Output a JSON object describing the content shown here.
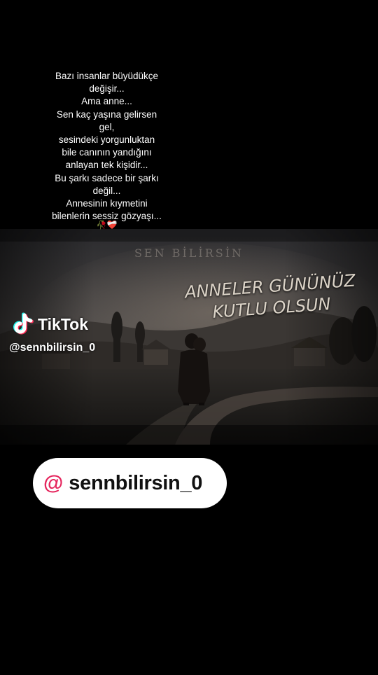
{
  "caption": {
    "lines": [
      "Bazı insanlar büyüdükçe",
      "değişir...",
      "Ama anne...",
      "Sen kaç yaşına gelirsen",
      "gel,",
      "sesindeki yorgunluktan",
      "bile canının yandığını",
      "anlayan tek kişidir...",
      "Bu şarkı sadece bir şarkı",
      "değil...",
      "Annesinin kıymetini",
      "bilenlerin sessiz gözyaşı..."
    ],
    "emoji": "🥀❤️‍🩹"
  },
  "video": {
    "watermark_title": "SEN BİLİRSİN",
    "greeting_line1": "ANNELER GÜNÜNÜZ",
    "greeting_line2": "KUTLU OLSUN"
  },
  "tiktok": {
    "logo_icon": "tiktok-note-icon",
    "brand": "TikTok",
    "handle": "@sennbilirsin_0"
  },
  "mention": {
    "at_symbol": "@",
    "username": "sennbilirsin_0",
    "accent_color": "#e5255d"
  },
  "colors": {
    "background": "#000000",
    "text": "#ffffff"
  }
}
